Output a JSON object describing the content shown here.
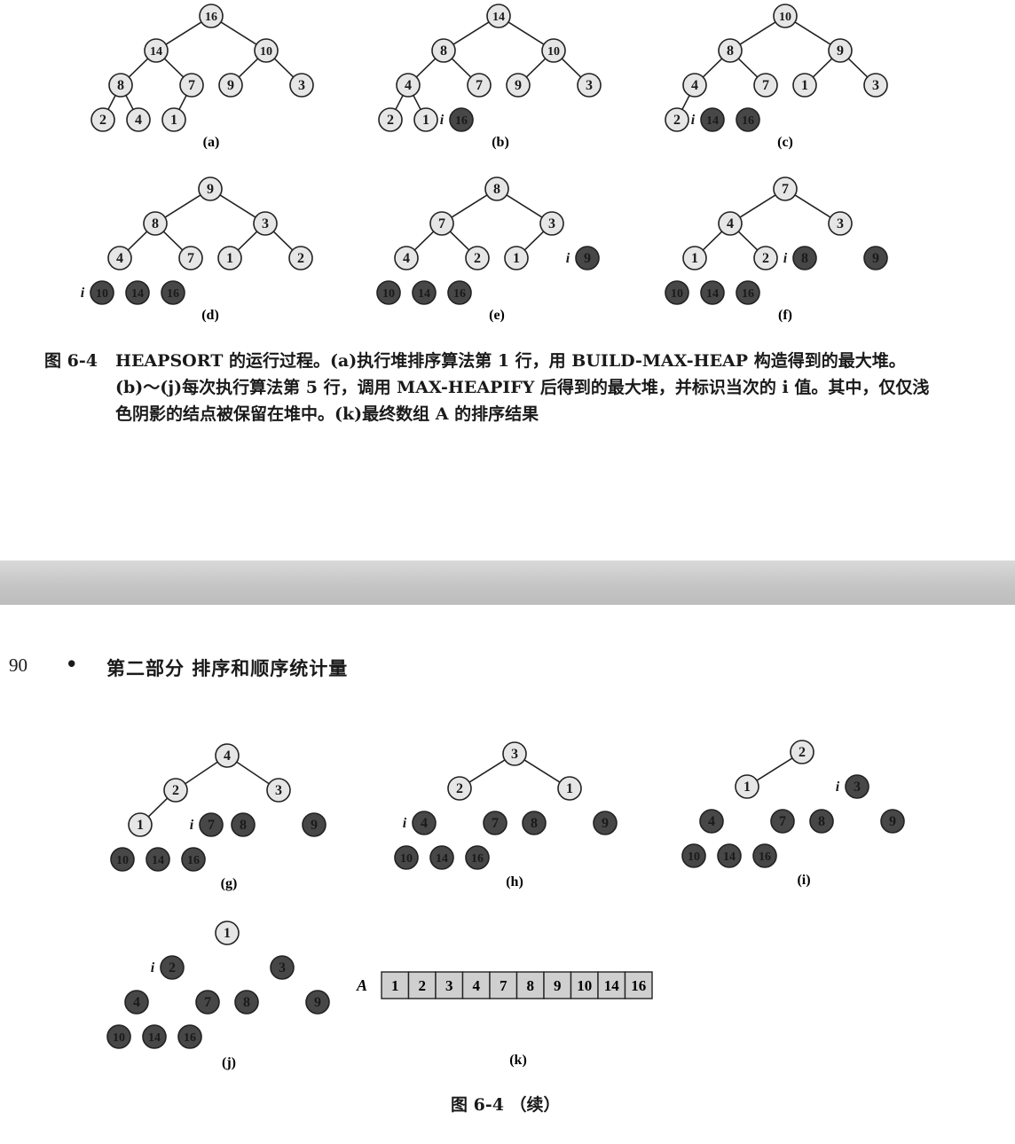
{
  "caption": {
    "label": "图 6-4",
    "text": "HEAPSORT 的运行过程。(a)执行堆排序算法第 1 行，用 BUILD-MAX-HEAP 构造得到的最大堆。(b)～(j)每次执行算法第 5 行，调用 MAX-HEAPIFY 后得到的最大堆，并标识当次的 i 值。其中，仅仅浅色阴影的结点被保留在堆中。(k)最终数组 A 的排序结果"
  },
  "page_header": {
    "page_number": "90",
    "separator": "•",
    "title": "第二部分   排序和顺序统计量"
  },
  "figure_continued": "图 6-4  （续）",
  "colors": {
    "light_node": "#e6e6e6",
    "dark_node": "#474747",
    "stroke": "#222222",
    "divider": "#c8c8c8"
  },
  "i_marker": "i",
  "trees": [
    {
      "label": "(a)",
      "nodes": [
        16,
        14,
        10,
        8,
        7,
        9,
        3,
        2,
        4,
        1
      ],
      "dark": [],
      "i_at": null
    },
    {
      "label": "(b)",
      "nodes": [
        14,
        8,
        10,
        4,
        7,
        9,
        3,
        2,
        1,
        16
      ],
      "dark": [
        9
      ],
      "i_at": 9
    },
    {
      "label": "(c)",
      "nodes": [
        10,
        8,
        9,
        4,
        7,
        1,
        3,
        2,
        14,
        16
      ],
      "dark": [
        8,
        9
      ],
      "i_at": 8
    },
    {
      "label": "(d)",
      "nodes": [
        9,
        8,
        3,
        4,
        7,
        1,
        2,
        10,
        14,
        16
      ],
      "dark": [
        7,
        8,
        9
      ],
      "i_at": 7
    },
    {
      "label": "(e)",
      "nodes": [
        8,
        7,
        3,
        4,
        2,
        1,
        9,
        10,
        14,
        16
      ],
      "dark": [
        6,
        7,
        8,
        9
      ],
      "i_at": 6
    },
    {
      "label": "(f)",
      "nodes": [
        7,
        4,
        3,
        1,
        2,
        8,
        9,
        10,
        14,
        16
      ],
      "dark": [
        5,
        6,
        7,
        8,
        9
      ],
      "i_at": 5
    },
    {
      "label": "(g)",
      "nodes": [
        4,
        2,
        3,
        1,
        7,
        8,
        9,
        10,
        14,
        16
      ],
      "dark": [
        4,
        5,
        6,
        7,
        8,
        9
      ],
      "i_at": 4
    },
    {
      "label": "(h)",
      "nodes": [
        3,
        2,
        1,
        4,
        7,
        8,
        9,
        10,
        14,
        16
      ],
      "dark": [
        3,
        4,
        5,
        6,
        7,
        8,
        9
      ],
      "i_at": 3
    },
    {
      "label": "(i)",
      "nodes": [
        2,
        1,
        3,
        4,
        7,
        8,
        9,
        10,
        14,
        16
      ],
      "dark": [
        2,
        3,
        4,
        5,
        6,
        7,
        8,
        9
      ],
      "i_at": 2
    },
    {
      "label": "(j)",
      "nodes": [
        1,
        2,
        3,
        4,
        7,
        8,
        9,
        10,
        14,
        16
      ],
      "dark": [
        1,
        2,
        3,
        4,
        5,
        6,
        7,
        8,
        9
      ],
      "i_at": 1
    }
  ],
  "array_k": {
    "label": "(k)",
    "name": "A",
    "values": [
      1,
      2,
      3,
      4,
      7,
      8,
      9,
      10,
      14,
      16
    ]
  }
}
